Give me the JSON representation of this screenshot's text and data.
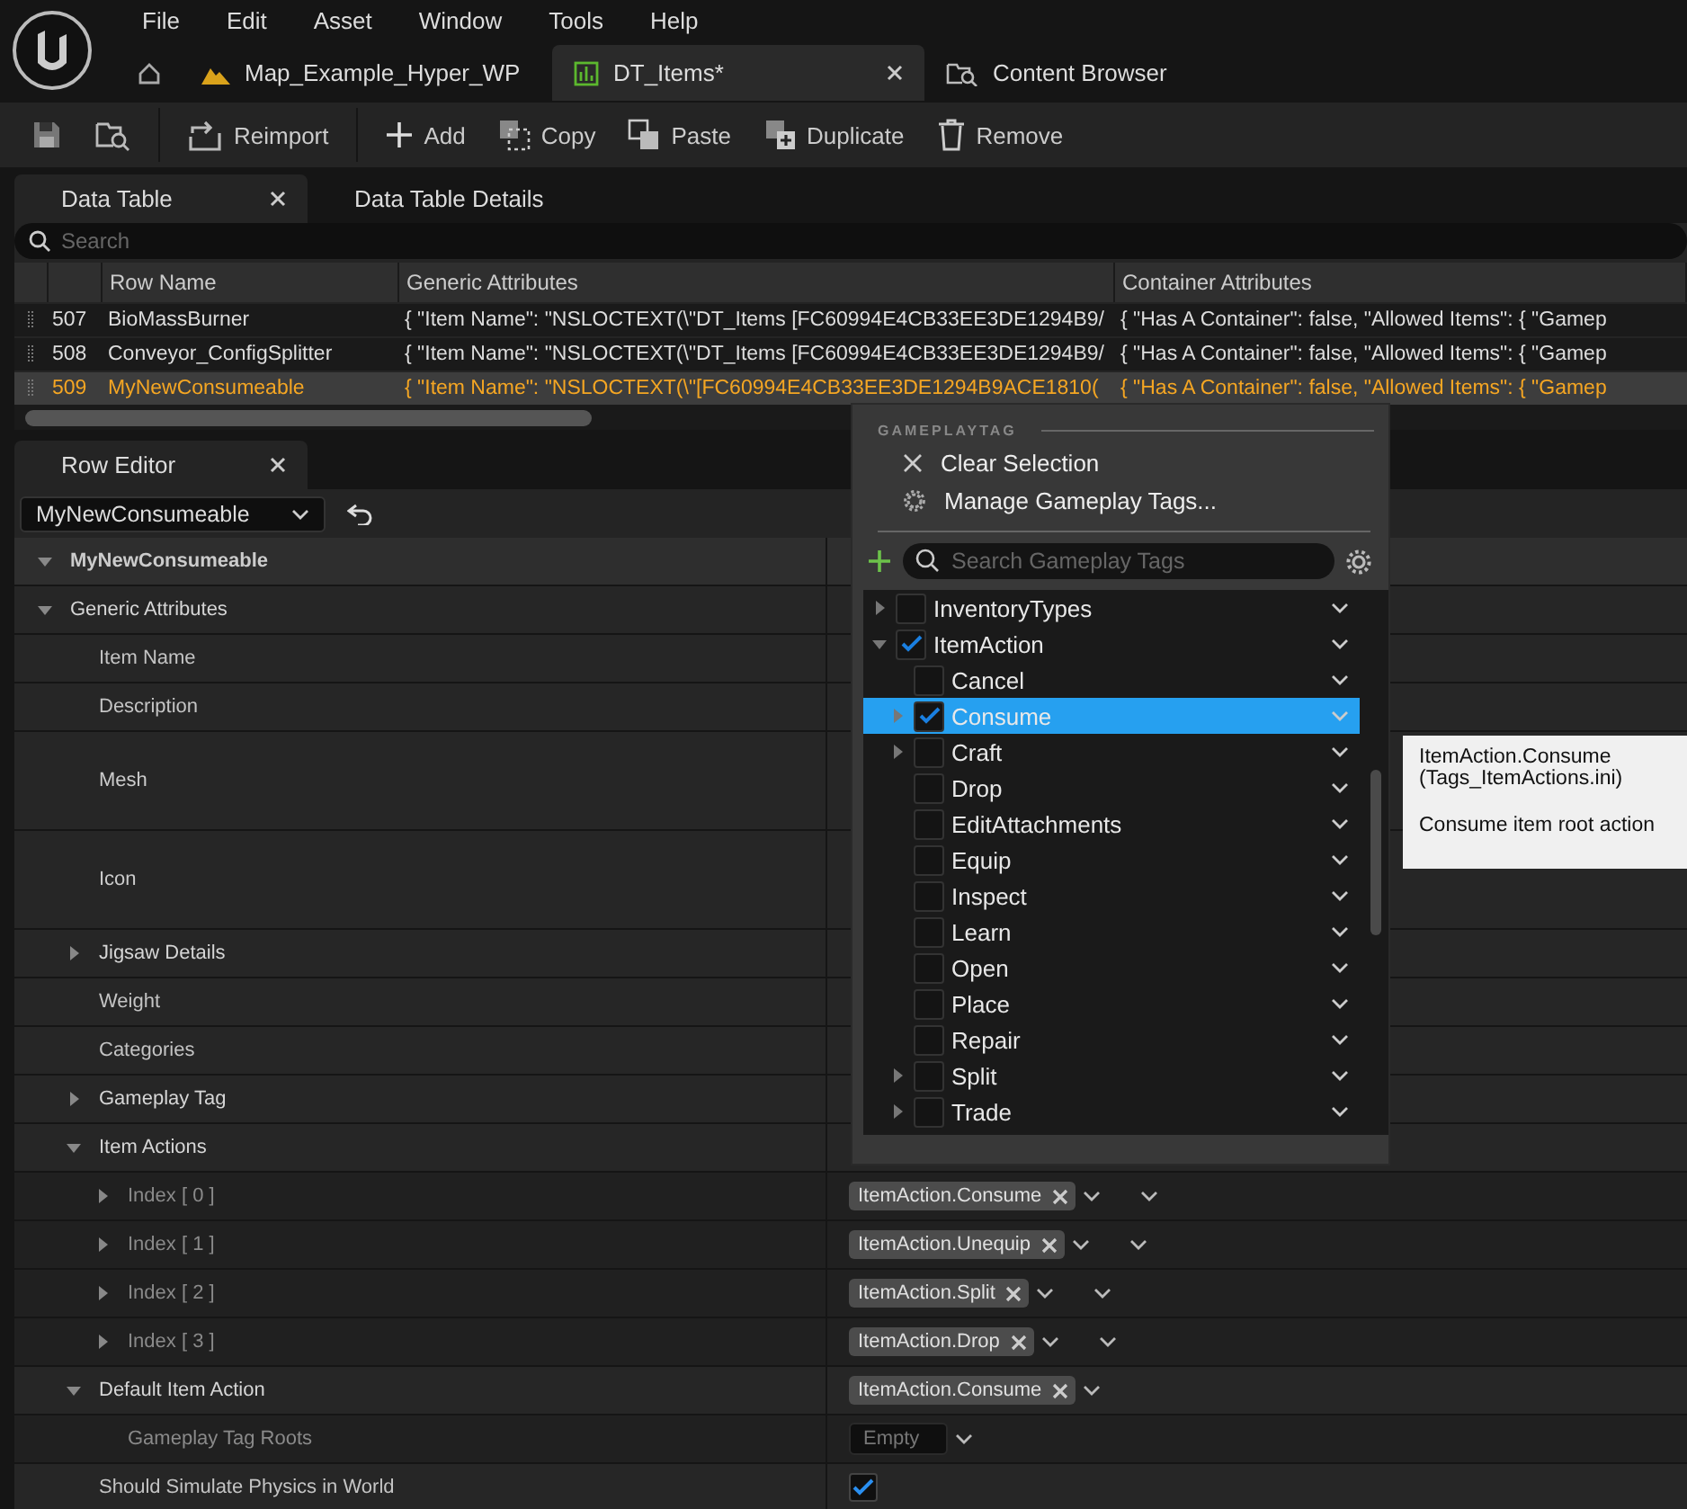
{
  "menu": [
    "File",
    "Edit",
    "Asset",
    "Window",
    "Tools",
    "Help"
  ],
  "doc_tabs": [
    {
      "label": "Map_Example_Hyper_WP",
      "kind": "level",
      "selected": false,
      "closable": false
    },
    {
      "label": "DT_Items*",
      "kind": "table",
      "selected": true,
      "closable": true
    },
    {
      "label": "Content Browser",
      "kind": "browser",
      "selected": false,
      "closable": false
    }
  ],
  "toolbar": [
    [
      {
        "kind": "save"
      },
      {
        "kind": "browse"
      }
    ],
    [
      {
        "kind": "reimport",
        "label": "Reimport"
      }
    ],
    [
      {
        "kind": "add",
        "label": "Add"
      },
      {
        "kind": "copy",
        "label": "Copy"
      },
      {
        "kind": "paste",
        "label": "Paste"
      },
      {
        "kind": "duplicate",
        "label": "Duplicate"
      },
      {
        "kind": "remove",
        "label": "Remove"
      }
    ]
  ],
  "panel_tabs": [
    {
      "label": "Data Table",
      "selected": true,
      "closable": true
    },
    {
      "label": "Data Table Details",
      "selected": false,
      "closable": false
    }
  ],
  "table": {
    "search_placeholder": "Search",
    "columns": [
      "Row Name",
      "Generic Attributes",
      "Container Attributes"
    ],
    "rows": [
      {
        "number": "507",
        "name": "BioMassBurner",
        "generic": "{ \"Item Name\": \"NSLOCTEXT(\\\"DT_Items [FC60994E4CB33EE3DE1294B9/",
        "container": "{ \"Has A Container\": false, \"Allowed Items\": { \"Gamep",
        "selected": false
      },
      {
        "number": "508",
        "name": "Conveyor_ConfigSplitter",
        "generic": "{ \"Item Name\": \"NSLOCTEXT(\\\"DT_Items [FC60994E4CB33EE3DE1294B9/",
        "container": "{ \"Has A Container\": false, \"Allowed Items\": { \"Gamep",
        "selected": false
      },
      {
        "number": "509",
        "name": "MyNewConsumeable",
        "generic": "{ \"Item Name\": \"NSLOCTEXT(\\\"[FC60994E4CB33EE3DE1294B9ACE1810(",
        "container": "{ \"Has A Container\": false, \"Allowed Items\": { \"Gamep",
        "selected": true
      }
    ]
  },
  "row_editor": {
    "tab": "Row Editor",
    "row_picker": "MyNewConsumeable",
    "properties": [
      {
        "label": "MyNewConsumeable",
        "kind": "category",
        "expanded": true,
        "children": [
          {
            "label": "Generic Attributes",
            "kind": "group",
            "expanded": true,
            "children": [
              {
                "label": "Item Name",
                "kind": "property"
              },
              {
                "label": "Description",
                "kind": "property"
              },
              {
                "label": "Mesh",
                "kind": "tall"
              },
              {
                "label": "Icon",
                "kind": "tall"
              },
              {
                "label": "Jigsaw Details",
                "kind": "group",
                "expanded": false
              },
              {
                "label": "Weight",
                "kind": "property"
              },
              {
                "label": "Categories",
                "kind": "property"
              },
              {
                "label": "Gameplay Tag",
                "kind": "group",
                "expanded": false
              },
              {
                "label": "Item Actions",
                "kind": "group",
                "expanded": true,
                "children": [
                  {
                    "label": "Index [ 0 ]",
                    "kind": "element",
                    "expanded": false,
                    "value": {
                      "kind": "tag_element",
                      "tag": "ItemAction.Consume"
                    }
                  },
                  {
                    "label": "Index [ 1 ]",
                    "kind": "element",
                    "expanded": false,
                    "value": {
                      "kind": "tag_element",
                      "tag": "ItemAction.Unequip"
                    }
                  },
                  {
                    "label": "Index [ 2 ]",
                    "kind": "element",
                    "expanded": false,
                    "value": {
                      "kind": "tag_element",
                      "tag": "ItemAction.Split"
                    }
                  },
                  {
                    "label": "Index [ 3 ]",
                    "kind": "element",
                    "expanded": false,
                    "value": {
                      "kind": "tag_element",
                      "tag": "ItemAction.Drop"
                    }
                  }
                ]
              },
              {
                "label": "Default Item Action",
                "kind": "group",
                "expanded": true,
                "value": {
                  "kind": "tag",
                  "tag": "ItemAction.Consume"
                },
                "children": [
                  {
                    "label": "Gameplay Tag Roots",
                    "kind": "element",
                    "value": {
                      "kind": "tag_field",
                      "placeholder": "Empty"
                    }
                  }
                ]
              },
              {
                "label": "Should Simulate Physics in World",
                "kind": "property",
                "value": {
                  "kind": "checkbox",
                  "checked": true
                }
              }
            ]
          }
        ]
      }
    ]
  },
  "tag_picker": {
    "heading": "GAMEPLAYTAG",
    "actions": [
      {
        "kind": "clear",
        "label": "Clear Selection"
      },
      {
        "kind": "manage",
        "label": "Manage Gameplay Tags..."
      }
    ],
    "search_placeholder": "Search Gameplay Tags",
    "tags": [
      {
        "label": "InventoryTypes",
        "checked": false,
        "selected": false,
        "expanded": false
      },
      {
        "label": "ItemAction",
        "checked": true,
        "selected": false,
        "expanded": true,
        "children": [
          {
            "label": "Cancel",
            "checked": false,
            "selected": false
          },
          {
            "label": "Consume",
            "checked": true,
            "selected": true,
            "expanded": false
          },
          {
            "label": "Craft",
            "checked": false,
            "selected": false,
            "expanded": false
          },
          {
            "label": "Drop",
            "checked": false,
            "selected": false
          },
          {
            "label": "EditAttachments",
            "checked": false,
            "selected": false
          },
          {
            "label": "Equip",
            "checked": false,
            "selected": false
          },
          {
            "label": "Inspect",
            "checked": false,
            "selected": false
          },
          {
            "label": "Learn",
            "checked": false,
            "selected": false
          },
          {
            "label": "Open",
            "checked": false,
            "selected": false
          },
          {
            "label": "Place",
            "checked": false,
            "selected": false
          },
          {
            "label": "Repair",
            "checked": false,
            "selected": false
          },
          {
            "label": "Split",
            "checked": false,
            "selected": false,
            "expanded": false
          },
          {
            "label": "Trade",
            "checked": false,
            "selected": false,
            "expanded": false
          }
        ]
      }
    ]
  },
  "tooltip": {
    "title": "ItemAction.Consume",
    "source": "(Tags_ItemActions.ini)",
    "description": "Consume item root action"
  }
}
